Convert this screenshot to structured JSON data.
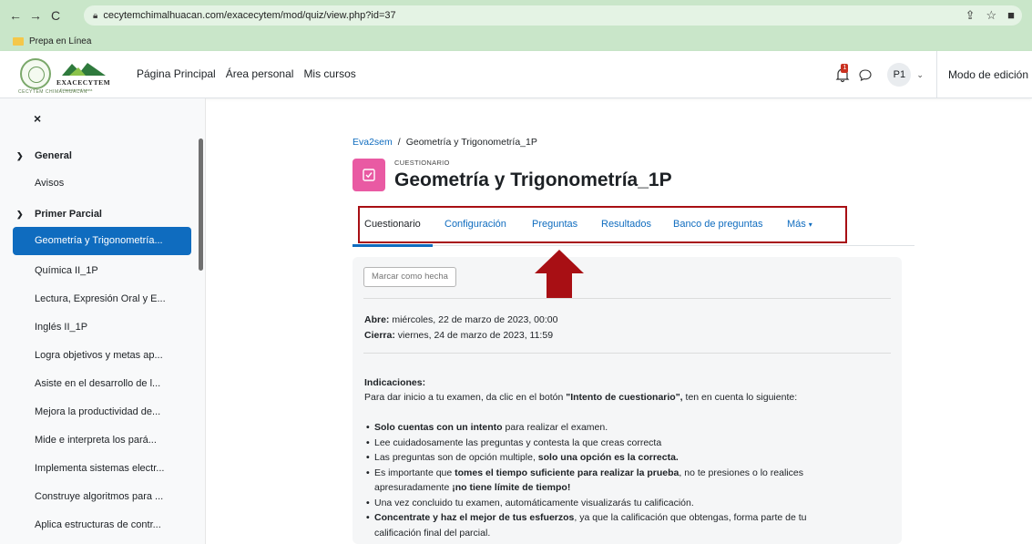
{
  "browser": {
    "url": "cecytemchimalhuacan.com/exacecytem/mod/quiz/view.php?id=37",
    "bookmark": "Prepa en Línea"
  },
  "navbar": {
    "logo_small": "CECYTEM CHIMALHUACÁN",
    "logo_brand": "EXACECYTEM",
    "logo_tag": "Educación en Línea",
    "links": [
      "Página Principal",
      "Área personal",
      "Mis cursos"
    ],
    "notification_count": "1",
    "avatar_initials": "P1",
    "edit_mode": "Modo de edición"
  },
  "drawer": {
    "close": "×",
    "items": [
      {
        "label": "General",
        "type": "section"
      },
      {
        "label": "Avisos",
        "type": "item"
      },
      {
        "label": "Primer Parcial",
        "type": "section"
      },
      {
        "label": "Geometría y Trigonometría...",
        "type": "active"
      },
      {
        "label": "Química II_1P",
        "type": "item"
      },
      {
        "label": "Lectura, Expresión Oral y E...",
        "type": "item"
      },
      {
        "label": "Inglés II_1P",
        "type": "item"
      },
      {
        "label": "Logra objetivos y metas ap...",
        "type": "item"
      },
      {
        "label": "Asiste en el desarrollo de l...",
        "type": "item"
      },
      {
        "label": "Mejora la productividad de...",
        "type": "item"
      },
      {
        "label": "Mide e interpreta los pará...",
        "type": "item"
      },
      {
        "label": "Implementa sistemas electr...",
        "type": "item"
      },
      {
        "label": "Construye algoritmos para ...",
        "type": "item"
      },
      {
        "label": "Aplica estructuras de contr...",
        "type": "item"
      }
    ]
  },
  "main": {
    "breadcrumb": [
      "Eva2sem",
      "/",
      "Geometría y Trigonometría_1P"
    ],
    "activity_type": "CUESTIONARIO",
    "title": "Geometría y Trigonometría_1P",
    "tabs": [
      "Cuestionario",
      "Configuración",
      "Preguntas",
      "Resultados",
      "Banco de preguntas",
      "Más"
    ],
    "mark_done": "Marcar como hecha",
    "opens_label": "Abre:",
    "opens_value": "miércoles, 22 de marzo de 2023, 00:00",
    "closes_label": "Cierra:",
    "closes_value": "viernes, 24 de marzo de 2023, 11:59",
    "indicaciones_title": "Indicaciones:",
    "intro_pre": "Para dar inicio a tu examen, da clic en el botón ",
    "intro_bold": "\"Intento de cuestionario\",",
    "intro_post": " ten en cuenta lo siguiente:",
    "b1_bold": "Solo cuentas con un intento",
    "b1_rest": " para realizar el examen.",
    "b2": "Lee cuidadosamente las preguntas y contesta la que creas correcta",
    "b3_pre": "Las preguntas son de opción multiple, ",
    "b3_bold": "solo una opción es la correcta.",
    "b4_pre": "Es importante que ",
    "b4_bold": "tomes el tiempo suficiente para realizar la prueba",
    "b4_post": ", no te presiones o lo realices",
    "b4_line2_pre": "apresuradamente ",
    "b4_line2_bold": "¡no tiene límite de tiempo!",
    "b5": "Una vez concluido tu examen, automáticamente visualizarás tu calificación.",
    "b6_bold": "Concentrate y haz el mejor de tus esfuerzos",
    "b6_post": ", ya que la calificación que obtengas, forma parte de tu",
    "b6_line2": "calificación final del parcial."
  },
  "colors": {
    "browser_green": "#c9e6c9",
    "link_blue": "#0f6cbf",
    "quiz_icon_pink": "#e95aa3",
    "annotation_red": "#a80f14"
  }
}
